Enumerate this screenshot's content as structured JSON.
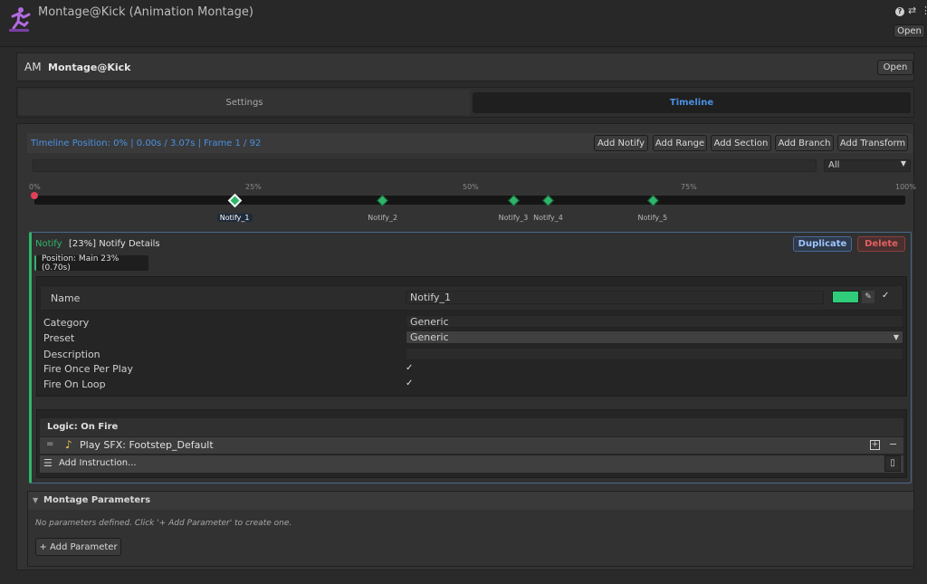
{
  "window": {
    "title": "Montage@Kick (Animation Montage)",
    "open_label": "Open",
    "help_icon": "help-icon",
    "settings_icon": "sliders-icon",
    "menu_icon": "kebab-menu-icon"
  },
  "asset": {
    "badge": "AM",
    "name": "Montage@Kick",
    "open_label": "Open"
  },
  "tabs": [
    {
      "label": "Settings",
      "active": false
    },
    {
      "label": "Timeline",
      "active": true
    }
  ],
  "timeline": {
    "position_text": "Timeline Position: 0% | 0.00s / 3.07s | Frame 1 / 92",
    "buttons": [
      "Add Notify",
      "Add Range",
      "Add Section",
      "Add Branch",
      "Add Transform"
    ],
    "filter_value": "All",
    "ticks": [
      "0%",
      "25%",
      "50%",
      "75%",
      "100%"
    ],
    "notifies": [
      {
        "label": "Notify_1",
        "percent": 23,
        "selected": true
      },
      {
        "label": "Notify_2",
        "percent": 40,
        "selected": false
      },
      {
        "label": "Notify_3",
        "percent": 55,
        "selected": false
      },
      {
        "label": "Notify_4",
        "percent": 59,
        "selected": false
      },
      {
        "label": "Notify_5",
        "percent": 71,
        "selected": false
      }
    ],
    "playhead_percent": 0
  },
  "details": {
    "type_label": "Notify",
    "title": "[23%] Notify Details",
    "duplicate_label": "Duplicate",
    "delete_label": "Delete",
    "position_label": "Position: Main 23% (0.70s)",
    "name_label": "Name",
    "name_value": "Notify_1",
    "color": "#2fcc7a",
    "category_label": "Category",
    "category_value": "Generic",
    "preset_label": "Preset",
    "preset_value": "Generic",
    "description_label": "Description",
    "description_value": "",
    "fire_once_label": "Fire Once Per Play",
    "fire_once_checked": true,
    "fire_on_loop_label": "Fire On Loop",
    "fire_on_loop_checked": true
  },
  "logic": {
    "title": "Logic: On Fire",
    "instruction_handle": "=",
    "instruction_label": "Play SFX: Footstep_Default",
    "add_instruction_label": "Add Instruction..."
  },
  "parameters": {
    "title": "Montage Parameters",
    "empty_text": "No parameters defined. Click '+ Add Parameter' to create one.",
    "add_label": "+ Add Parameter"
  },
  "colors": {
    "accent_blue": "#4a90e2",
    "notify_green": "#2fb56a",
    "delete_red": "#e06060",
    "duplicate_blue": "#9cc4ff"
  }
}
